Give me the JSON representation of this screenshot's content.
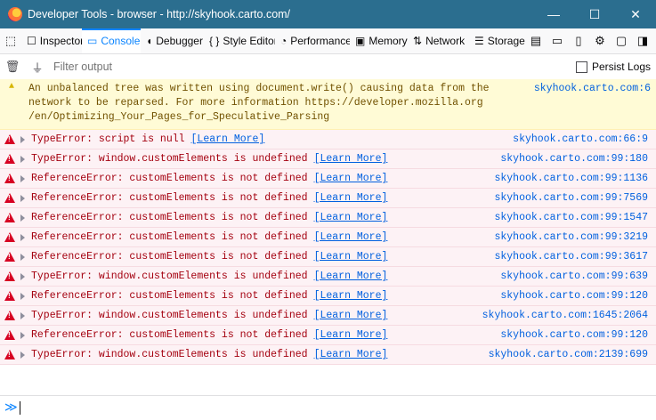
{
  "window": {
    "title": "Developer Tools - browser - http://skyhook.carto.com/",
    "minimize_glyph": "—",
    "maximize_glyph": "☐",
    "close_glyph": "✕"
  },
  "toolbar": {
    "picker_icon": "⬚",
    "tabs": [
      {
        "label": "Inspector",
        "icon": "☐",
        "active": false
      },
      {
        "label": "Console",
        "icon": "▭",
        "active": true
      },
      {
        "label": "Debugger",
        "icon": "◖",
        "active": false
      },
      {
        "label": "Style Editor",
        "icon": "{ }",
        "active": false
      },
      {
        "label": "Performance",
        "icon": "◔",
        "active": false
      },
      {
        "label": "Memory",
        "icon": "▣",
        "active": false
      },
      {
        "label": "Network",
        "icon": "⇅",
        "active": false
      },
      {
        "label": "Storage",
        "icon": "☰",
        "active": false
      }
    ],
    "right_icons": [
      "▤",
      "▭",
      "▯",
      "⚙",
      "▢",
      "◨"
    ]
  },
  "filterbar": {
    "trash_glyph": "🗑",
    "filter_glyph": "⏚",
    "placeholder": "Filter output",
    "persist_label": "Persist Logs"
  },
  "warning": {
    "text": "An unbalanced tree was written using document.write() causing data from the\nnetwork to be reparsed. For more information https://developer.mozilla.org\n/en/Optimizing_Your_Pages_for_Speculative_Parsing",
    "location": "skyhook.carto.com:6",
    "icon": "▲"
  },
  "errors": [
    {
      "message": "TypeError: script is null",
      "link": "[Learn More]",
      "location": "skyhook.carto.com:66:9"
    },
    {
      "message": "TypeError: window.customElements is undefined",
      "link": "[Learn More]",
      "location": "skyhook.carto.com:99:180"
    },
    {
      "message": "ReferenceError: customElements is not defined",
      "link": "[Learn More]",
      "location": "skyhook.carto.com:99:1136"
    },
    {
      "message": "ReferenceError: customElements is not defined",
      "link": "[Learn More]",
      "location": "skyhook.carto.com:99:7569"
    },
    {
      "message": "ReferenceError: customElements is not defined",
      "link": "[Learn More]",
      "location": "skyhook.carto.com:99:1547"
    },
    {
      "message": "ReferenceError: customElements is not defined",
      "link": "[Learn More]",
      "location": "skyhook.carto.com:99:3219"
    },
    {
      "message": "ReferenceError: customElements is not defined",
      "link": "[Learn More]",
      "location": "skyhook.carto.com:99:3617"
    },
    {
      "message": "TypeError: window.customElements is undefined",
      "link": "[Learn More]",
      "location": "skyhook.carto.com:99:639"
    },
    {
      "message": "ReferenceError: customElements is not defined",
      "link": "[Learn More]",
      "location": "skyhook.carto.com:99:120"
    },
    {
      "message": "TypeError: window.customElements is undefined",
      "link": "[Learn More]",
      "location": "skyhook.carto.com:1645:2064"
    },
    {
      "message": "ReferenceError: customElements is not defined",
      "link": "[Learn More]",
      "location": "skyhook.carto.com:99:120"
    },
    {
      "message": "TypeError: window.customElements is undefined",
      "link": "[Learn More]",
      "location": "skyhook.carto.com:2139:699"
    }
  ],
  "input": {
    "prompt": "≫"
  },
  "colors": {
    "titlebar": "#2b6e8f",
    "accent": "#0a84ff",
    "error_text": "#a4000f",
    "warning_bg": "#fffbd6"
  }
}
